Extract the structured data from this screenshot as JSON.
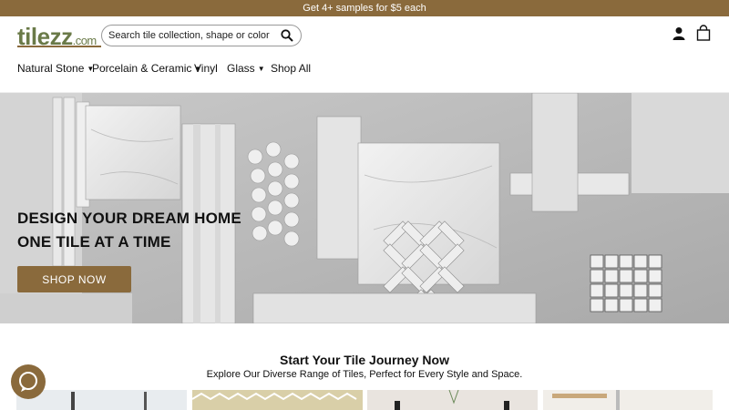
{
  "promo": {
    "text": "Get 4+ samples for $5 each"
  },
  "header": {
    "logo_main": "tilezz",
    "logo_suffix": ".com",
    "search_placeholder": "Search tile collection, shape or color"
  },
  "nav": {
    "items": [
      {
        "label": "Natural Stone",
        "has_dropdown": true
      },
      {
        "label": "Porcelain & Ceramic",
        "has_dropdown": true
      },
      {
        "label": "Vinyl",
        "has_dropdown": false
      },
      {
        "label": "Glass",
        "has_dropdown": true
      },
      {
        "label": "Shop All",
        "has_dropdown": false
      }
    ]
  },
  "hero": {
    "line1": "DESIGN YOUR DREAM HOME",
    "line2": "ONE TILE AT A TIME",
    "button_label": "SHOP NOW"
  },
  "journey": {
    "title": "Start Your Tile Journey Now",
    "subtitle": "Explore Our Diverse Range of Tiles, Perfect for Every Style and Space."
  },
  "icons": {
    "search": "search-icon",
    "account": "user-icon",
    "cart": "shopping-bag-icon",
    "chat": "chat-bubble-icon",
    "chevron": "chevron-down-icon"
  },
  "colors": {
    "brand_brown": "#8a6a3c",
    "logo_green": "#6a7a48"
  }
}
